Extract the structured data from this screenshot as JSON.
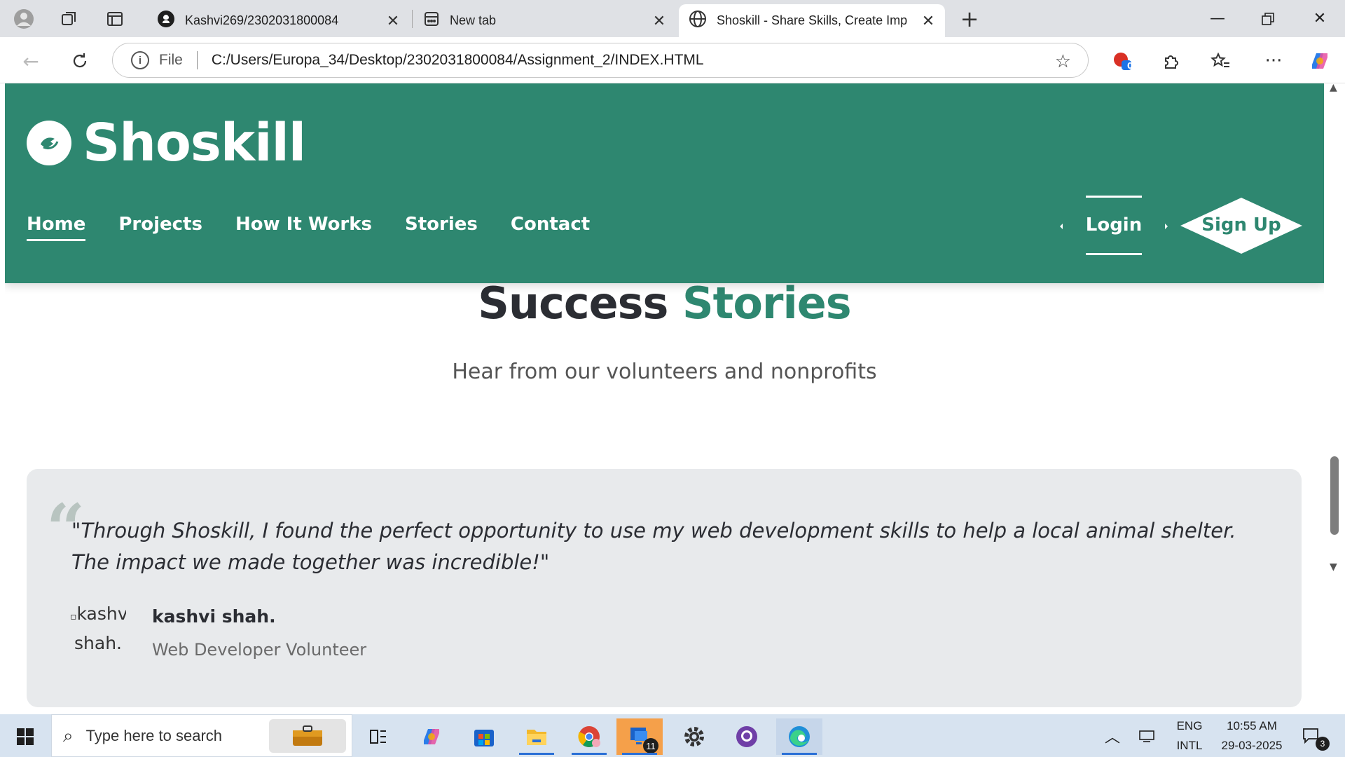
{
  "browser": {
    "tabs": [
      {
        "title": "Kashvi269/2302031800084",
        "icon": "github-icon"
      },
      {
        "title": "New tab",
        "icon": "new-tab-icon"
      },
      {
        "title": "Shoskill - Share Skills, Create Imp",
        "icon": "globe-icon"
      }
    ],
    "url_prefix": "File",
    "url": "C:/Users/Europa_34/Desktop/2302031800084/Assignment_2/INDEX.HTML",
    "extension_badge": "0"
  },
  "site": {
    "brand": "Shoskill",
    "nav": [
      "Home",
      "Projects",
      "How It Works",
      "Stories",
      "Contact"
    ],
    "login": "Login",
    "signup": "Sign Up",
    "colors": {
      "primary": "#2e8770",
      "dark": "#2b2d33"
    }
  },
  "stories": {
    "title_part1": "Success",
    "title_part2": "Stories",
    "subtitle": "Hear from our volunteers and nonprofits",
    "quote_mark": "“",
    "quote": "\"Through Shoskill, I found the perfect opportunity to use my web development skills to help a local animal shelter. The impact we made together was incredible!\"",
    "avatar_alt": "kashvi shah.",
    "author": "kashvi shah.",
    "role": "Web Developer Volunteer"
  },
  "taskbar": {
    "search_placeholder": "Type here to search",
    "badge_count": "11",
    "language": "ENG",
    "layout": "INTL",
    "time": "10:55 AM",
    "date": "29-03-2025",
    "notifications": "3"
  }
}
